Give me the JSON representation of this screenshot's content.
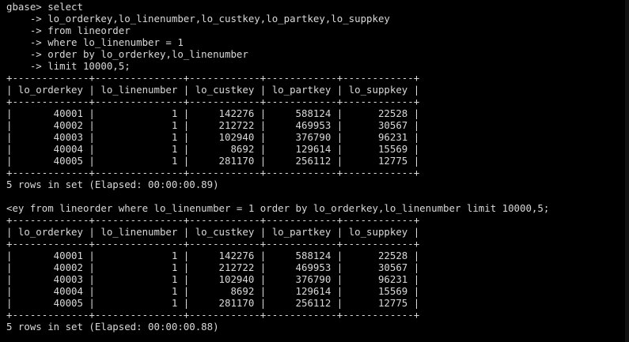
{
  "terminal": {
    "lines": [
      "gbase> select",
      "    -> lo_orderkey,lo_linenumber,lo_custkey,lo_partkey,lo_suppkey",
      "    -> from lineorder",
      "    -> where lo_linenumber = 1",
      "    -> order by lo_orderkey,lo_linenumber",
      "    -> limit 10000,5;",
      "+-------------+---------------+------------+------------+------------+",
      "| lo_orderkey | lo_linenumber | lo_custkey | lo_partkey | lo_suppkey |",
      "+-------------+---------------+------------+------------+------------+",
      "|       40001 |             1 |     142276 |     588124 |      22528 |",
      "|       40002 |             1 |     212722 |     469953 |      30567 |",
      "|       40003 |             1 |     102940 |     376790 |      96231 |",
      "|       40004 |             1 |       8692 |     129614 |      15569 |",
      "|       40005 |             1 |     281170 |     256112 |      12775 |",
      "+-------------+---------------+------------+------------+------------+",
      "5 rows in set (Elapsed: 00:00:00.89)",
      "",
      "<ey from lineorder where lo_linenumber = 1 order by lo_orderkey,lo_linenumber limit 10000,5;",
      "+-------------+---------------+------------+------------+------------+",
      "| lo_orderkey | lo_linenumber | lo_custkey | lo_partkey | lo_suppkey |",
      "+-------------+---------------+------------+------------+------------+",
      "|       40001 |             1 |     142276 |     588124 |      22528 |",
      "|       40002 |             1 |     212722 |     469953 |      30567 |",
      "|       40003 |             1 |     102940 |     376790 |      96231 |",
      "|       40004 |             1 |       8692 |     129614 |      15569 |",
      "|       40005 |             1 |     281170 |     256112 |      12775 |",
      "+-------------+---------------+------------+------------+------------+",
      "5 rows in set (Elapsed: 00:00:00.88)"
    ]
  },
  "colors": {
    "background": "#000000",
    "text": "#d9d9d9"
  }
}
